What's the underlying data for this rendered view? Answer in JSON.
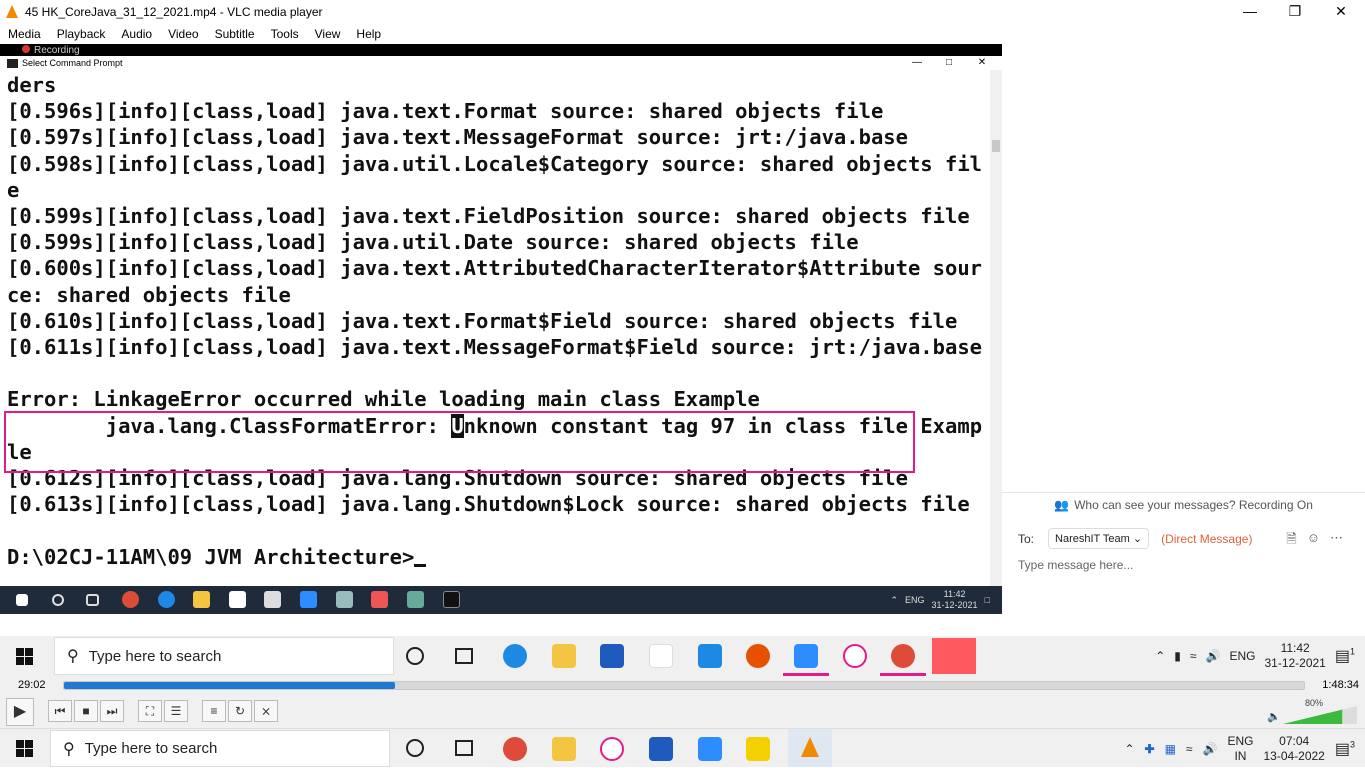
{
  "window": {
    "title": "45 HK_CoreJava_31_12_2021.mp4 - VLC media player"
  },
  "menu": [
    "Media",
    "Playback",
    "Audio",
    "Video",
    "Subtitle",
    "Tools",
    "View",
    "Help"
  ],
  "video": {
    "recording_label": "Recording",
    "cmd": {
      "title": "Select Command Prompt",
      "lines": [
        "ders",
        "[0.596s][info][class,load] java.text.Format source: shared objects file",
        "[0.597s][info][class,load] java.text.MessageFormat source: jrt:/java.base",
        "[0.598s][info][class,load] java.util.Locale$Category source: shared objects fil",
        "e",
        "[0.599s][info][class,load] java.text.FieldPosition source: shared objects file",
        "[0.599s][info][class,load] java.util.Date source: shared objects file",
        "[0.600s][info][class,load] java.text.AttributedCharacterIterator$Attribute sour",
        "ce: shared objects file",
        "[0.610s][info][class,load] java.text.Format$Field source: shared objects file",
        "[0.611s][info][class,load] java.text.MessageFormat$Field source: jrt:/java.base",
        "",
        "Error: LinkageError occurred while loading main class Example",
        "        java.lang.ClassFormatError: ",
        "le",
        "[0.612s][info][class,load] java.lang.Shutdown source: shared objects file",
        "[0.613s][info][class,load] java.lang.Shutdown$Lock source: shared objects file",
        "",
        "D:\\02CJ-11AM\\09 JVM Architecture>"
      ],
      "error_caret_char": "U",
      "error_rest": "nknown constant tag 97 in class file Examp"
    },
    "inner_tray": {
      "lang": "ENG",
      "time": "11:42",
      "date": "31-12-2021"
    },
    "chat": {
      "who_can_see": "Who can see your messages? Recording On",
      "to_label": "To:",
      "recipient": "NareshIT Team",
      "direct_message": "(Direct Message)",
      "placeholder": "Type message here..."
    },
    "taskbar": {
      "search_placeholder": "Type here to search",
      "lang": "ENG",
      "time": "11:42",
      "date": "31-12-2021",
      "notif_count": "1"
    }
  },
  "playback": {
    "elapsed": "29:02",
    "total": "1:48:34",
    "progress_fraction": 0.267,
    "volume_percent": "80%",
    "volume_level": 0.8
  },
  "taskbar": {
    "search_placeholder": "Type here to search",
    "lang_top": "ENG",
    "lang_bottom": "IN",
    "time": "07:04",
    "date": "13-04-2022",
    "notif_count": "3"
  }
}
